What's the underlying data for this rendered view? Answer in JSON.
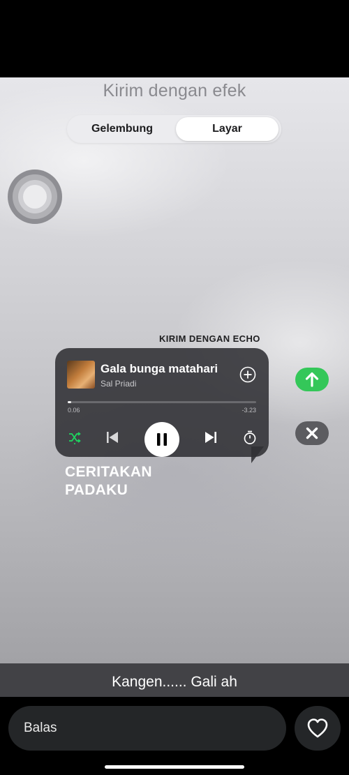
{
  "header": {
    "title": "Kirim dengan efek"
  },
  "segment": {
    "options": [
      "Gelembung",
      "Layar"
    ],
    "selected": "Layar"
  },
  "echo": {
    "label": "KIRIM DENGAN ECHO"
  },
  "player": {
    "song_title": "Gala bunga matahari",
    "artist": "Sal Priadi",
    "elapsed": "0.06",
    "remaining": "-3.23",
    "progress_fraction": 0.02,
    "state": "playing"
  },
  "message": {
    "text": "CERITAKAN PADAKU"
  },
  "actions": {
    "send_icon": "arrow-up-icon",
    "cancel_icon": "close-icon",
    "send_color": "#34c759"
  },
  "story": {
    "caption": "Kangen...... Gali ah"
  },
  "composer": {
    "placeholder": "Balas",
    "like_icon": "heart-icon"
  }
}
